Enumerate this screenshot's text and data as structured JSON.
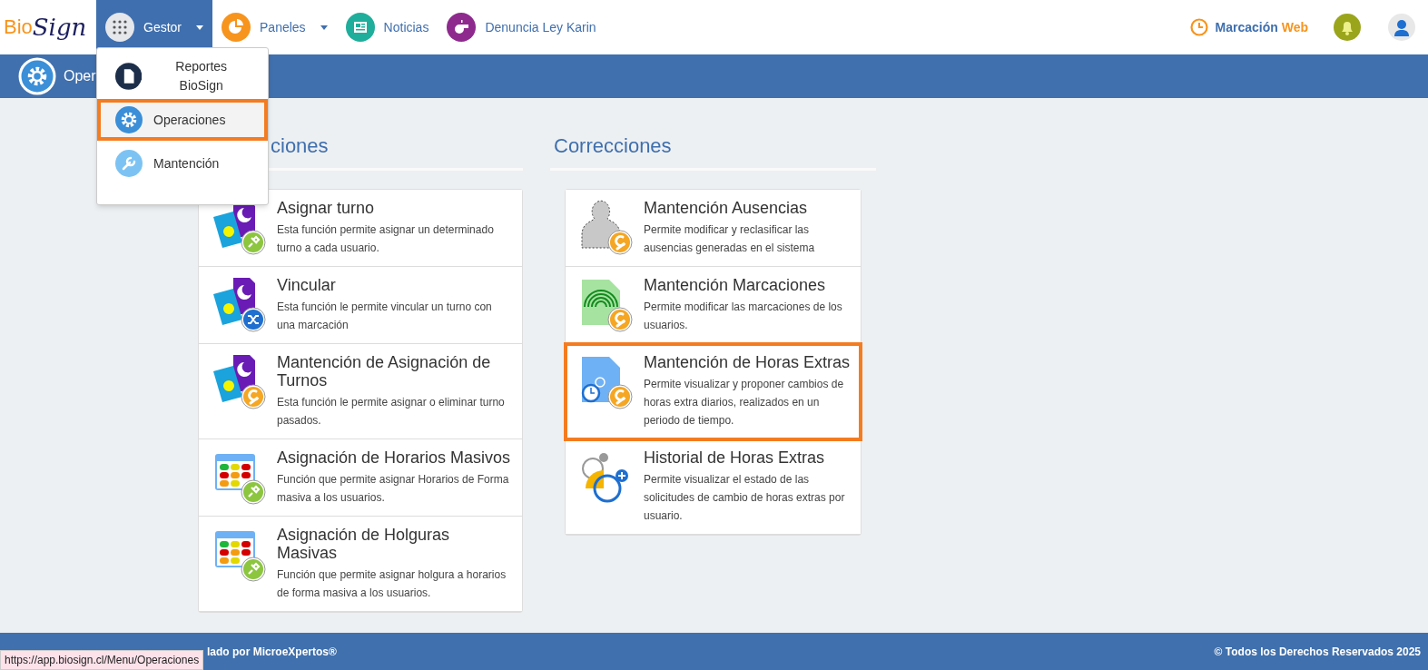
{
  "navbar": {
    "logo": {
      "prefix": "Bio",
      "suffix": "Sign"
    },
    "items": [
      {
        "label": "Gestor",
        "kind": "grid",
        "dropdown": true,
        "selected": true
      },
      {
        "label": "Paneles",
        "kind": "chart",
        "dropdown": true,
        "selected": false
      },
      {
        "label": "Noticias",
        "kind": "news",
        "dropdown": false,
        "selected": false
      },
      {
        "label": "Denuncia Ley Karin",
        "kind": "whistle",
        "dropdown": false,
        "selected": false
      }
    ],
    "clock_in": {
      "label": "Marcación",
      "accent": "Web"
    }
  },
  "dropdown": {
    "items": [
      {
        "label": "Reportes BioSign",
        "kind": "document",
        "highlighted": false
      },
      {
        "label": "Operaciones",
        "kind": "gear",
        "highlighted": true
      },
      {
        "label": "Mantención",
        "kind": "wrench",
        "highlighted": false
      }
    ]
  },
  "page_header": {
    "title": "Oper"
  },
  "sections": [
    {
      "title": "ciones",
      "cards": [
        {
          "title": "Asignar turno",
          "description": "Esta función permite asignar un determinado turno a cada usuario.",
          "kind": "shiftpin",
          "highlighted": false
        },
        {
          "title": "Vincular",
          "description": "Esta función le permite vincular un turno con una marcación",
          "kind": "shiftshuffle",
          "highlighted": false
        },
        {
          "title": "Mantención de Asignación de Turnos",
          "description": "Esta función le permite asignar o eliminar turno pasados.",
          "kind": "shiftwrench",
          "highlighted": false
        },
        {
          "title": "Asignación de Horarios Masivos",
          "description": "Función que permite asignar Horarios de Forma masiva a los usuarios.",
          "kind": "calendarpin",
          "highlighted": false
        },
        {
          "title": "Asignación de Holguras Masivas",
          "description": "Función que permite asignar holgura a horarios de forma masiva a los usuarios.",
          "kind": "calendarpin",
          "highlighted": false
        }
      ]
    },
    {
      "title": "Correcciones",
      "cards": [
        {
          "title": "Mantención Ausencias",
          "description": "Permite modificar y reclasificar las ausencias generadas en el sistema",
          "kind": "personwrench",
          "highlighted": false
        },
        {
          "title": "Mantención Marcaciones",
          "description": "Permite modificar las marcaciones de los usuarios.",
          "kind": "fingerprintwrench",
          "highlighted": false
        },
        {
          "title": "Mantención de Horas Extras",
          "description": "Permite visualizar y proponer cambios de horas extra diarios, realizados en un periodo de tiempo.",
          "kind": "clockdocwrench",
          "highlighted": true
        },
        {
          "title": "Historial de Horas Extras",
          "description": "Permite visualizar el estado de las solicitudes de cambio de horas extras por usuario.",
          "kind": "clocks",
          "highlighted": false
        }
      ]
    }
  ],
  "footer": {
    "left": "lado por MicroeXpertos®",
    "right": "© Todos los Derechos Reservados 2025"
  },
  "status_url": "https://app.biosign.cl/Menu/Operaciones"
}
